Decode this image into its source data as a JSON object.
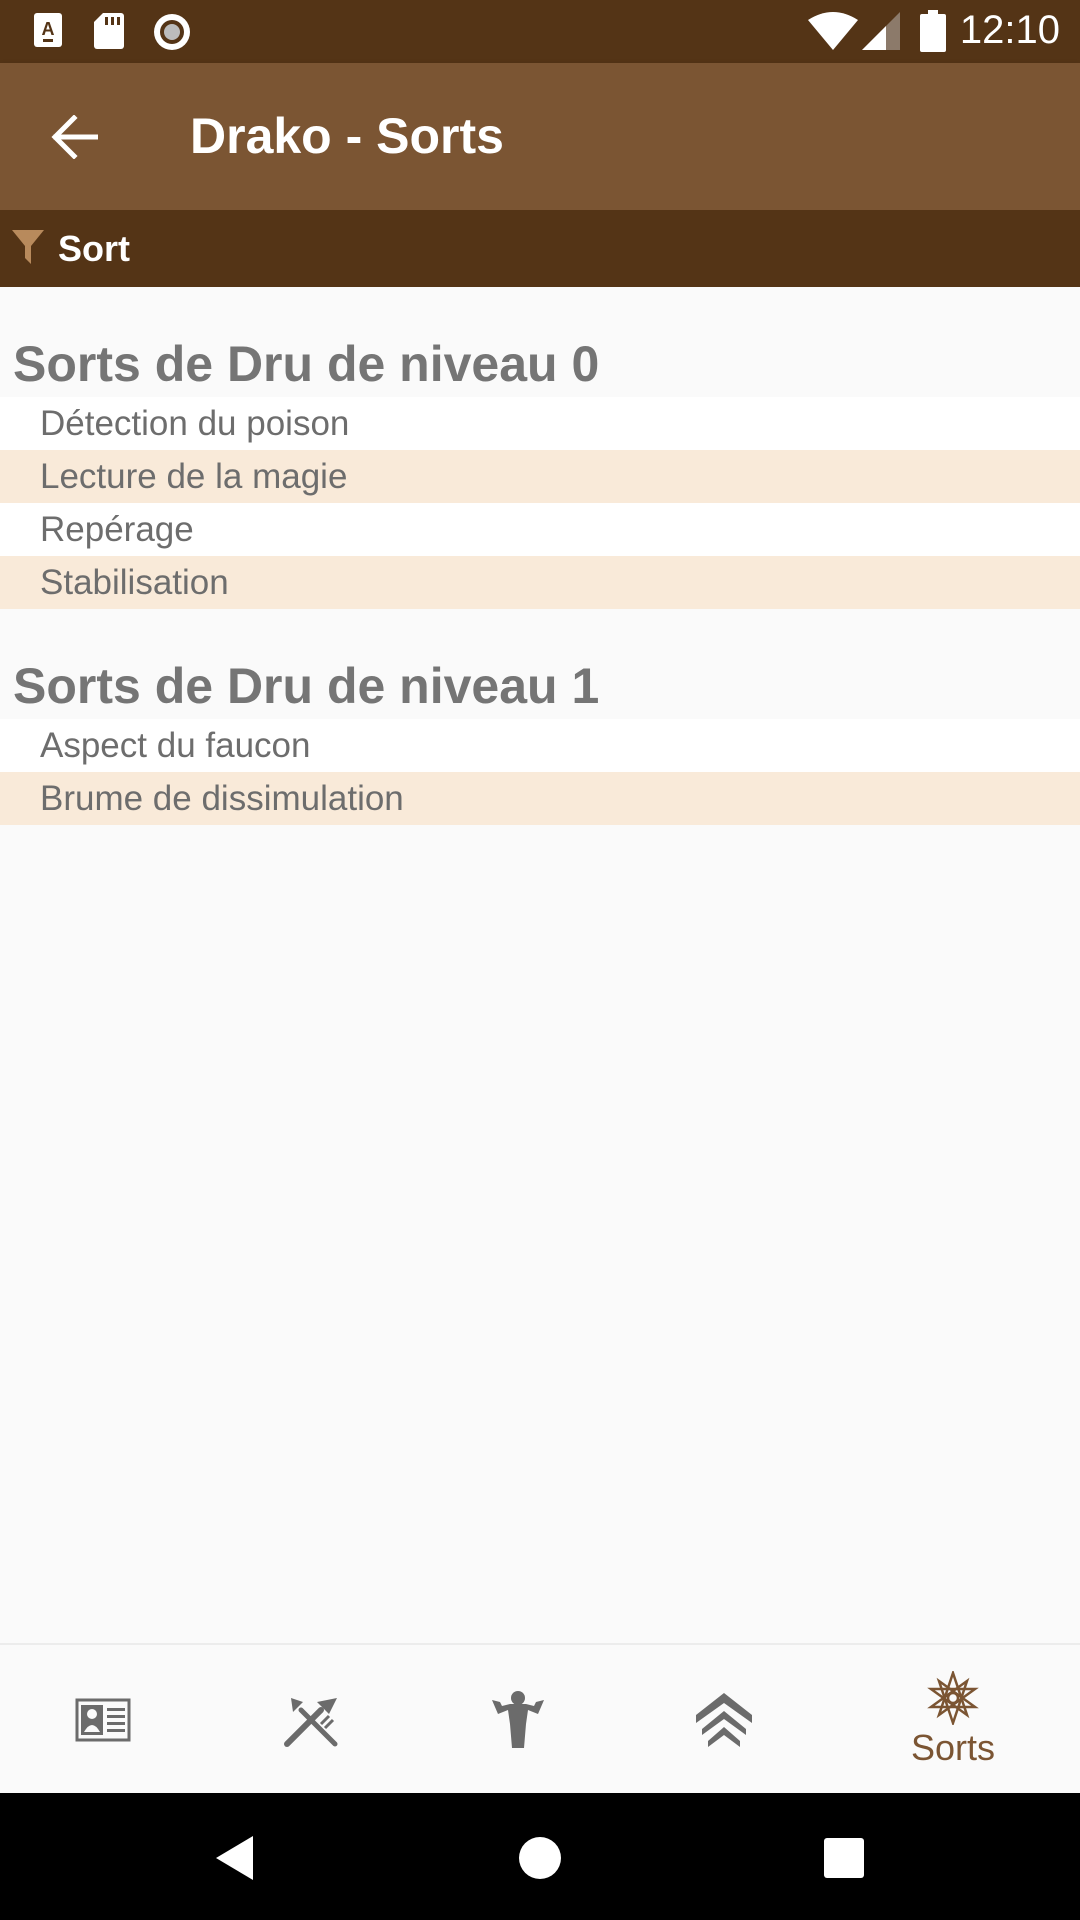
{
  "status_bar": {
    "time": "12:10",
    "icons": [
      "notification-a-icon",
      "sd-card-icon",
      "record-icon",
      "wifi-icon",
      "signal-icon",
      "battery-icon"
    ]
  },
  "app_bar": {
    "title": "Drako - Sorts",
    "back_icon": "arrow-back-icon"
  },
  "sort_bar": {
    "label": "Sort",
    "icon": "filter-icon"
  },
  "sections": [
    {
      "title": "Sorts de Dru de niveau 0",
      "items": [
        "Détection du poison",
        "Lecture de la magie",
        "Repérage",
        "Stabilisation"
      ]
    },
    {
      "title": "Sorts de Dru de niveau 1",
      "items": [
        "Aspect du faucon",
        "Brume de dissimulation"
      ]
    }
  ],
  "bottom_nav": {
    "items": [
      {
        "icon": "character-card-icon",
        "label": ""
      },
      {
        "icon": "crossed-tools-icon",
        "label": ""
      },
      {
        "icon": "strength-figure-icon",
        "label": ""
      },
      {
        "icon": "rank-chevrons-icon",
        "label": ""
      },
      {
        "icon": "star-spell-icon",
        "label": "Sorts"
      }
    ],
    "active_index": 4
  },
  "colors": {
    "status_bar": "#543416",
    "app_bar": "#7b5533",
    "sort_bar": "#543416",
    "row_alt": "#f9ead9",
    "accent": "#7b5533"
  }
}
